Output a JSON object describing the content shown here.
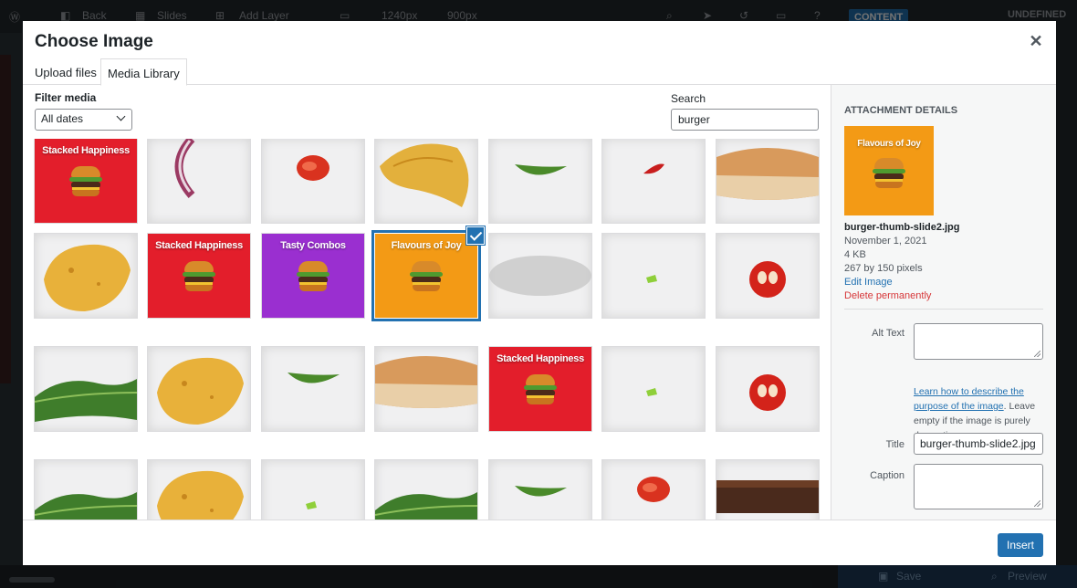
{
  "background_editor": {
    "topbar_items": [
      "Back",
      "Slides",
      "Add Layer",
      "1240px",
      "900px"
    ],
    "content_tab": "CONTENT",
    "right_label": "UNDEFINED",
    "save_label": "Save",
    "preview_label": "Preview"
  },
  "modal": {
    "title": "Choose Image",
    "close_icon": "close-icon",
    "tabs": [
      {
        "label": "Upload files",
        "active": false
      },
      {
        "label": "Media Library",
        "active": true
      }
    ],
    "filter": {
      "label": "Filter media",
      "selected": "All dates"
    },
    "search": {
      "label": "Search",
      "value": "burger"
    },
    "grid": {
      "rows": [
        [
          {
            "kind": "poster",
            "title": "Stacked Happiness",
            "color": "#e31e2b"
          },
          {
            "kind": "onion"
          },
          {
            "kind": "tomato-slice"
          },
          {
            "kind": "chip-large"
          },
          {
            "kind": "leaf"
          },
          {
            "kind": "chili"
          },
          {
            "kind": "bun-side"
          }
        ],
        [
          {
            "kind": "chip"
          },
          {
            "kind": "poster",
            "title": "Stacked Happiness",
            "color": "#e31e2b"
          },
          {
            "kind": "poster",
            "title": "Tasty Combos",
            "color": "#9a2fd0"
          },
          {
            "kind": "poster",
            "title": "Flavours of Joy",
            "color": "#f39a15",
            "selected": true
          },
          {
            "kind": "blur"
          },
          {
            "kind": "green-bit"
          },
          {
            "kind": "tomato-red"
          }
        ],
        [
          {
            "kind": "lettuce"
          },
          {
            "kind": "chip"
          },
          {
            "kind": "leaf"
          },
          {
            "kind": "bun-side"
          },
          {
            "kind": "poster",
            "title": "Stacked Happiness",
            "color": "#e31e2b"
          },
          {
            "kind": "green-bit"
          },
          {
            "kind": "tomato-red"
          }
        ],
        [
          {
            "kind": "lettuce"
          },
          {
            "kind": "chip"
          },
          {
            "kind": "green-bit"
          },
          {
            "kind": "lettuce"
          },
          {
            "kind": "leaf"
          },
          {
            "kind": "tomato-slice"
          },
          {
            "kind": "patty-side"
          }
        ]
      ]
    },
    "details": {
      "heading": "Attachment Details",
      "thumb_title": "Flavours of Joy",
      "filename": "burger-thumb-slide2.jpg",
      "date": "November 1, 2021",
      "size": "4 KB",
      "dimensions": "267 by 150 pixels",
      "edit_link": "Edit Image",
      "delete_link": "Delete permanently",
      "alt_text_label": "Alt Text",
      "alt_text_value": "",
      "alt_help_link": "Learn how to describe the purpose of the image",
      "alt_help_text": ". Leave empty if the image is purely decorative.",
      "title_label": "Title",
      "title_value": "burger-thumb-slide2.jpg",
      "caption_label": "Caption",
      "caption_value": ""
    },
    "footer": {
      "insert_label": "Insert"
    }
  }
}
